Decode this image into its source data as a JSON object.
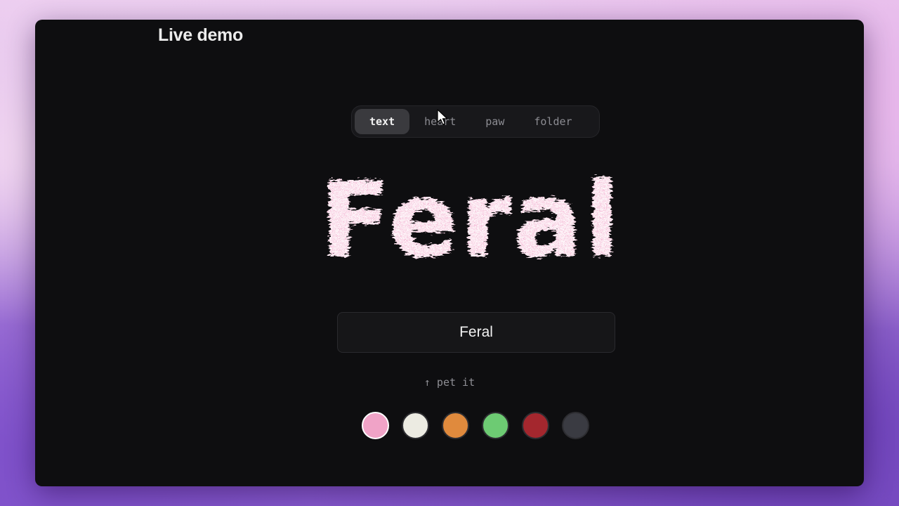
{
  "window": {
    "title": "Live demo"
  },
  "modes": {
    "tabs": [
      {
        "label": "text",
        "active": true
      },
      {
        "label": "heart",
        "active": false
      },
      {
        "label": "paw",
        "active": false
      },
      {
        "label": "folder",
        "active": false
      }
    ]
  },
  "preview": {
    "text": "Feral",
    "fur_color": "#f29ac6"
  },
  "input": {
    "value": "Feral"
  },
  "hint": {
    "text": "↑ pet it"
  },
  "swatches": [
    {
      "name": "pink",
      "color": "#f0a3c7",
      "selected": true
    },
    {
      "name": "cream",
      "color": "#ecebe2",
      "selected": false
    },
    {
      "name": "orange",
      "color": "#e08a3d",
      "selected": false
    },
    {
      "name": "green",
      "color": "#6dcb73",
      "selected": false
    },
    {
      "name": "red",
      "color": "#a4272e",
      "selected": false
    },
    {
      "name": "slate",
      "color": "#3a3b42",
      "selected": false
    }
  ]
}
